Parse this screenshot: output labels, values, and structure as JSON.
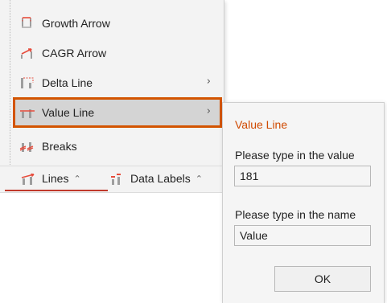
{
  "colors": {
    "accent": "#d04a02",
    "highlight_outline": "#d35400",
    "icon_red": "#e74c3c",
    "icon_gray": "#9e9e9e"
  },
  "menu": {
    "items": [
      {
        "label": "Growth Arrow",
        "icon": "growth-arrow-icon",
        "submenu": false
      },
      {
        "label": "CAGR Arrow",
        "icon": "cagr-arrow-icon",
        "submenu": false
      },
      {
        "label": "Delta Line",
        "icon": "delta-line-icon",
        "submenu": true,
        "chevron": "›"
      },
      {
        "label": "Value Line",
        "icon": "value-line-icon",
        "submenu": true,
        "chevron": "›",
        "selected": true
      },
      {
        "label": "Breaks",
        "icon": "breaks-icon",
        "submenu": false
      }
    ]
  },
  "toolbar": {
    "lines_label": "Lines",
    "lines_caret": "^",
    "data_labels_label": "Data Labels",
    "data_labels_caret": "^"
  },
  "panel": {
    "title": "Value Line",
    "value_label": "Please type in the value",
    "value": "181",
    "name_label": "Please type in the name",
    "name": "Value",
    "ok_label": "OK"
  }
}
